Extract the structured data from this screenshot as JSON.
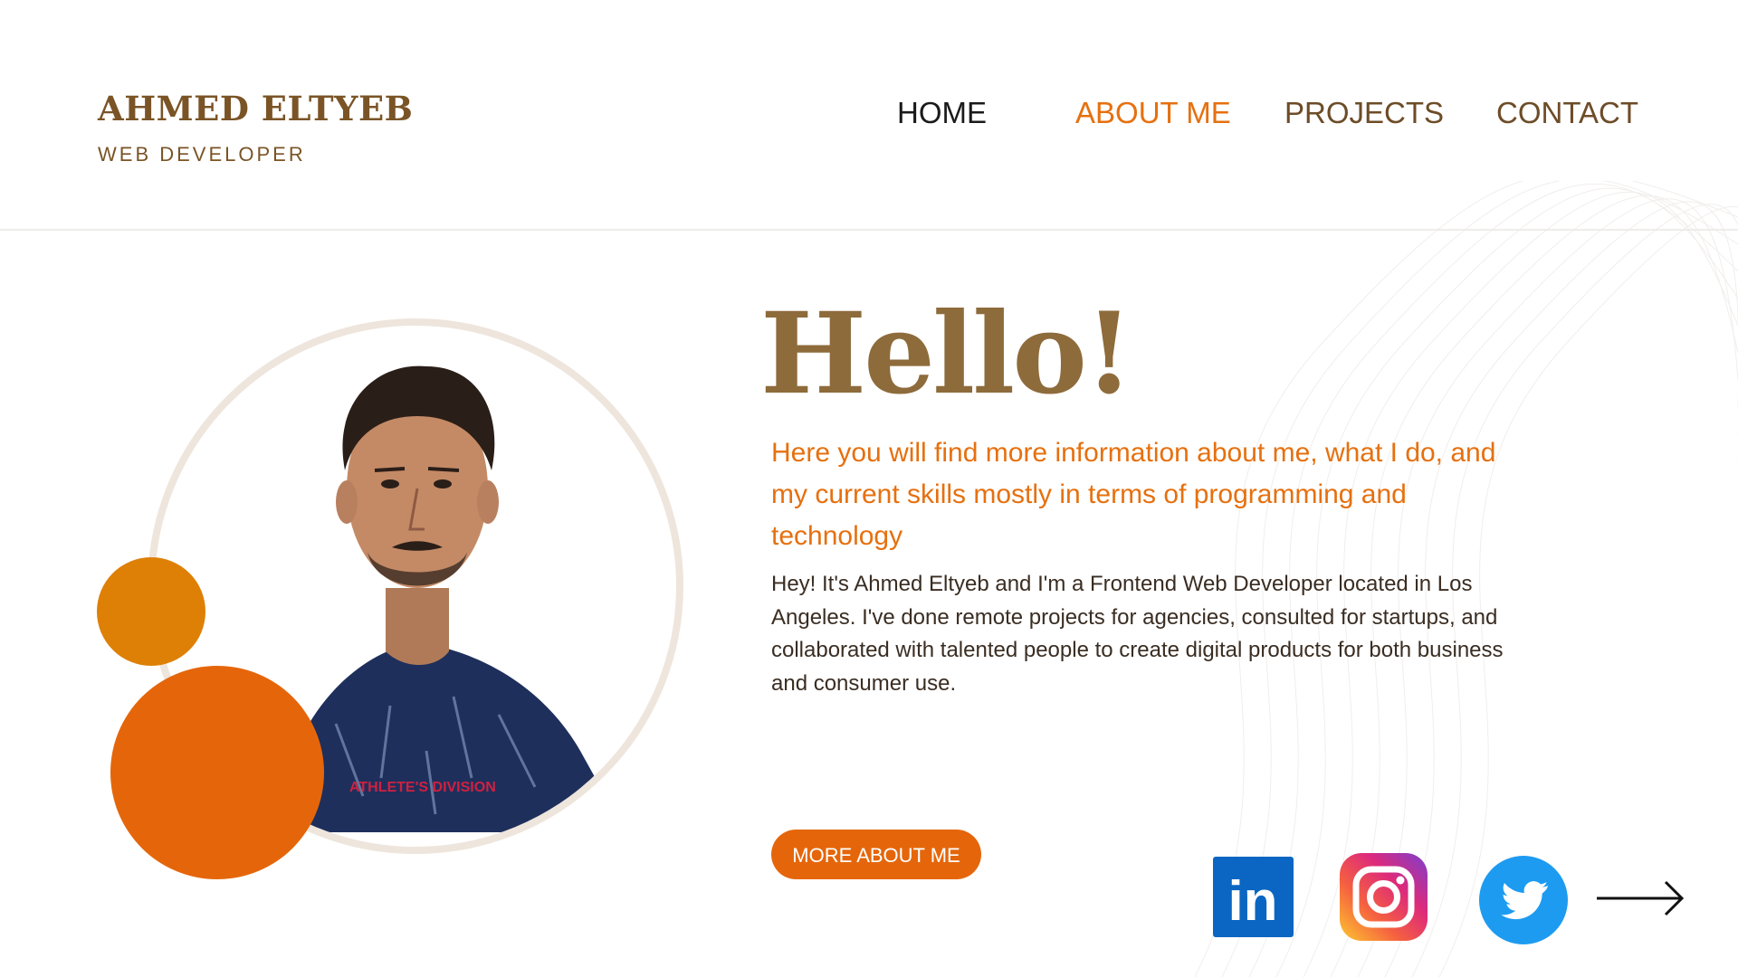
{
  "header": {
    "brand_name": "AHMED ELTYEB",
    "brand_role": "WEB DEVELOPER",
    "nav": [
      {
        "label": "HOME",
        "state": "default"
      },
      {
        "label": "ABOUT ME",
        "state": "active"
      },
      {
        "label": "PROJECTS",
        "state": "default"
      },
      {
        "label": "CONTACT",
        "state": "default"
      }
    ]
  },
  "hero": {
    "greeting": "Hello!",
    "lead": "Here you will find more information about me, what I do, and my current skills mostly in terms of programming and technology",
    "body": "Hey! It's Ahmed Eltyeb and I'm a Frontend Web Developer located in Los Angeles. I've done remote projects for agencies, consulted for startups, and collaborated with talented people to create digital products for both business and consumer use.",
    "button_label": "MORE ABOUT ME",
    "shirt_text": "ATHLETE'S DIVISION"
  },
  "social": {
    "linkedin_text": "in",
    "icons": [
      "linkedin-icon",
      "instagram-icon",
      "twitter-icon",
      "arrow-right-icon"
    ]
  },
  "colors": {
    "brand_brown": "#7a5426",
    "accent_orange": "#e6700f",
    "circle_small": "#de8006",
    "circle_big": "#e5660a",
    "greeting": "#8e6b3b",
    "ring": "#eee5dc"
  }
}
